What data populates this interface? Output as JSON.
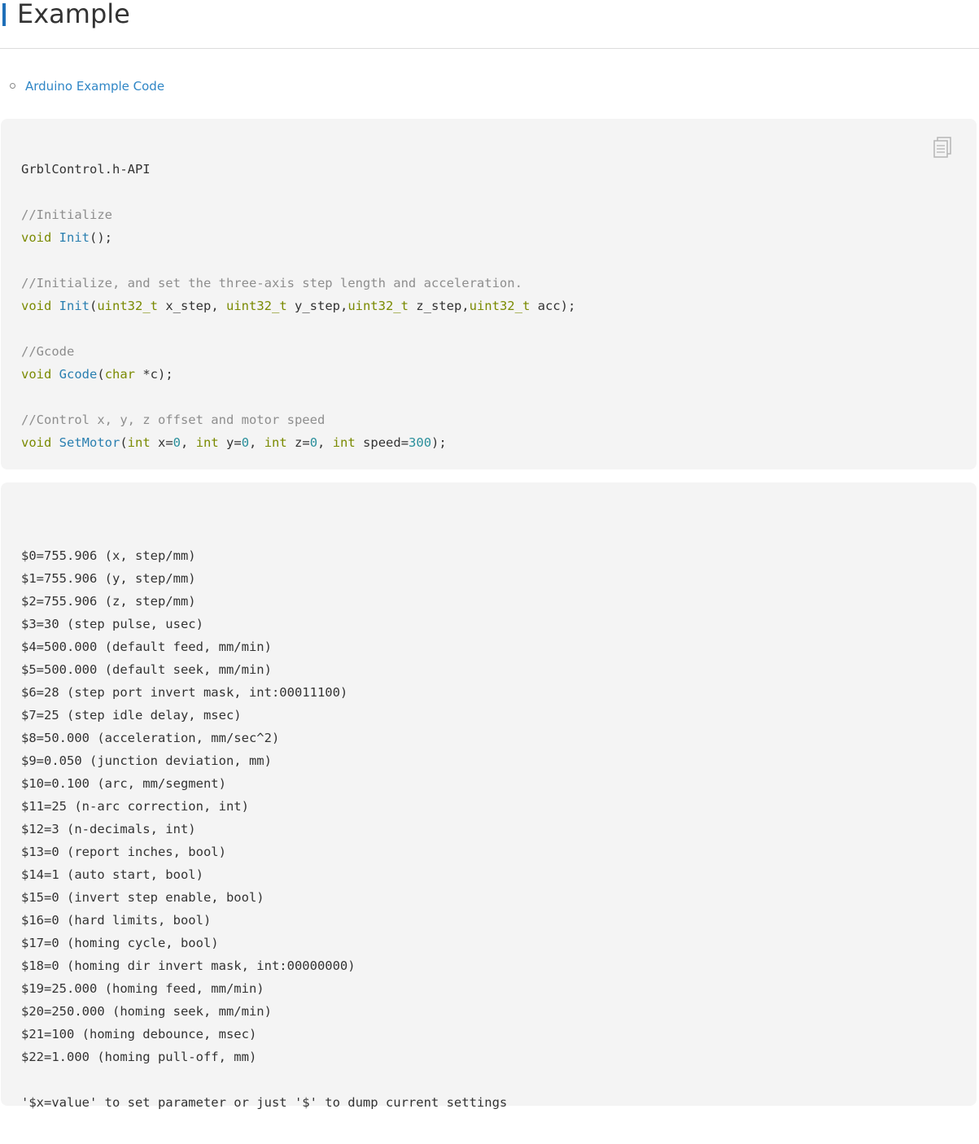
{
  "heading": "Example",
  "toc": {
    "link": "Arduino Example Code"
  },
  "block1": {
    "copy_icon": "copy-icon",
    "lines": [
      [
        {
          "t": "GrblControl.h-API",
          "c": "pl"
        }
      ],
      [],
      [
        {
          "t": "//Initialize",
          "c": "cmt"
        }
      ],
      [
        {
          "t": "void",
          "c": "kw"
        },
        {
          "t": " ",
          "c": "pl"
        },
        {
          "t": "Init",
          "c": "fn"
        },
        {
          "t": "();",
          "c": "pl"
        }
      ],
      [],
      [
        {
          "t": "//Initialize, and set the three-axis step length and acceleration.",
          "c": "cmt"
        }
      ],
      [
        {
          "t": "void",
          "c": "kw"
        },
        {
          "t": " ",
          "c": "pl"
        },
        {
          "t": "Init",
          "c": "fn"
        },
        {
          "t": "(",
          "c": "pl"
        },
        {
          "t": "uint32_t",
          "c": "ty"
        },
        {
          "t": " x_step, ",
          "c": "pl"
        },
        {
          "t": "uint32_t",
          "c": "ty"
        },
        {
          "t": " y_step,",
          "c": "pl"
        },
        {
          "t": "uint32_t",
          "c": "ty"
        },
        {
          "t": " z_step,",
          "c": "pl"
        },
        {
          "t": "uint32_t",
          "c": "ty"
        },
        {
          "t": " acc);",
          "c": "pl"
        }
      ],
      [],
      [
        {
          "t": "//Gcode",
          "c": "cmt"
        }
      ],
      [
        {
          "t": "void",
          "c": "kw"
        },
        {
          "t": " ",
          "c": "pl"
        },
        {
          "t": "Gcode",
          "c": "fn"
        },
        {
          "t": "(",
          "c": "pl"
        },
        {
          "t": "char",
          "c": "ty"
        },
        {
          "t": " *c);",
          "c": "pl"
        }
      ],
      [],
      [
        {
          "t": "//Control x, y, z offset and motor speed",
          "c": "cmt"
        }
      ],
      [
        {
          "t": "void",
          "c": "kw"
        },
        {
          "t": " ",
          "c": "pl"
        },
        {
          "t": "SetMotor",
          "c": "fn"
        },
        {
          "t": "(",
          "c": "pl"
        },
        {
          "t": "int",
          "c": "ty"
        },
        {
          "t": " x=",
          "c": "pl"
        },
        {
          "t": "0",
          "c": "num"
        },
        {
          "t": ", ",
          "c": "pl"
        },
        {
          "t": "int",
          "c": "ty"
        },
        {
          "t": " y=",
          "c": "pl"
        },
        {
          "t": "0",
          "c": "num"
        },
        {
          "t": ", ",
          "c": "pl"
        },
        {
          "t": "int",
          "c": "ty"
        },
        {
          "t": " z=",
          "c": "pl"
        },
        {
          "t": "0",
          "c": "num"
        },
        {
          "t": ", ",
          "c": "pl"
        },
        {
          "t": "int",
          "c": "ty"
        },
        {
          "t": " speed=",
          "c": "pl"
        },
        {
          "t": "300",
          "c": "num"
        },
        {
          "t": ");",
          "c": "pl"
        }
      ]
    ]
  },
  "block2": {
    "lines": [
      "",
      "$0=755.906 (x, step/mm)",
      "$1=755.906 (y, step/mm)",
      "$2=755.906 (z, step/mm)",
      "$3=30 (step pulse, usec)",
      "$4=500.000 (default feed, mm/min)",
      "$5=500.000 (default seek, mm/min)",
      "$6=28 (step port invert mask, int:00011100)",
      "$7=25 (step idle delay, msec)",
      "$8=50.000 (acceleration, mm/sec^2)",
      "$9=0.050 (junction deviation, mm)",
      "$10=0.100 (arc, mm/segment)",
      "$11=25 (n-arc correction, int)",
      "$12=3 (n-decimals, int)",
      "$13=0 (report inches, bool)",
      "$14=1 (auto start, bool)",
      "$15=0 (invert step enable, bool)",
      "$16=0 (hard limits, bool)",
      "$17=0 (homing cycle, bool)",
      "$18=0 (homing dir invert mask, int:00000000)",
      "$19=25.000 (homing feed, mm/min)",
      "$20=250.000 (homing seek, mm/min)",
      "$21=100 (homing debounce, msec)",
      "$22=1.000 (homing pull-off, mm)",
      "",
      "'$x=value' to set parameter or just '$' to dump current settings"
    ]
  }
}
